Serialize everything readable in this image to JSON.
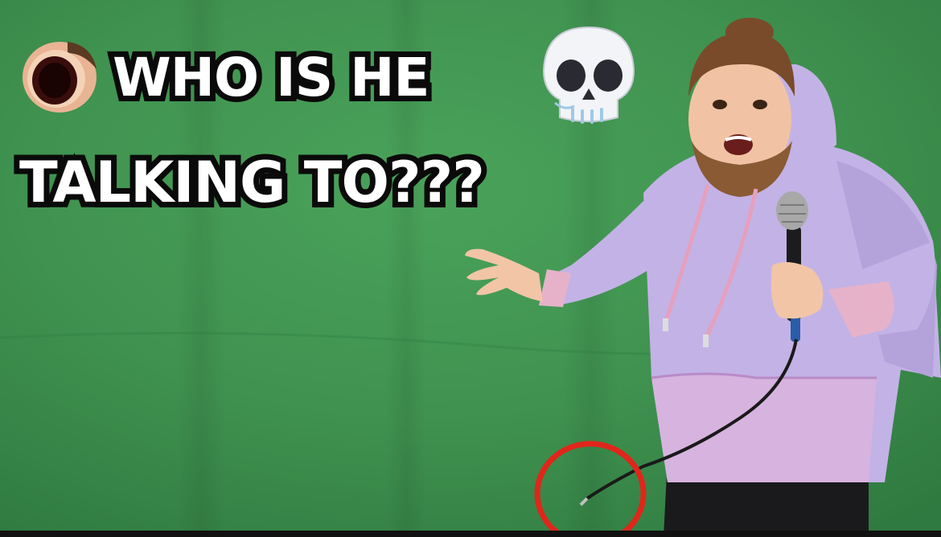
{
  "caption": {
    "line1": "WHO IS HE",
    "line2": "TALKING TO???"
  },
  "icons": {
    "left": "open-mouth-emoji",
    "right": "skull-emoji",
    "annotation": "red-circle"
  },
  "colors": {
    "background": "#3e8e4c",
    "text": "#ffffff",
    "text_outline": "#0a0a0a",
    "hoodie": "#c3b2e6",
    "annotation": "#e0261b"
  }
}
